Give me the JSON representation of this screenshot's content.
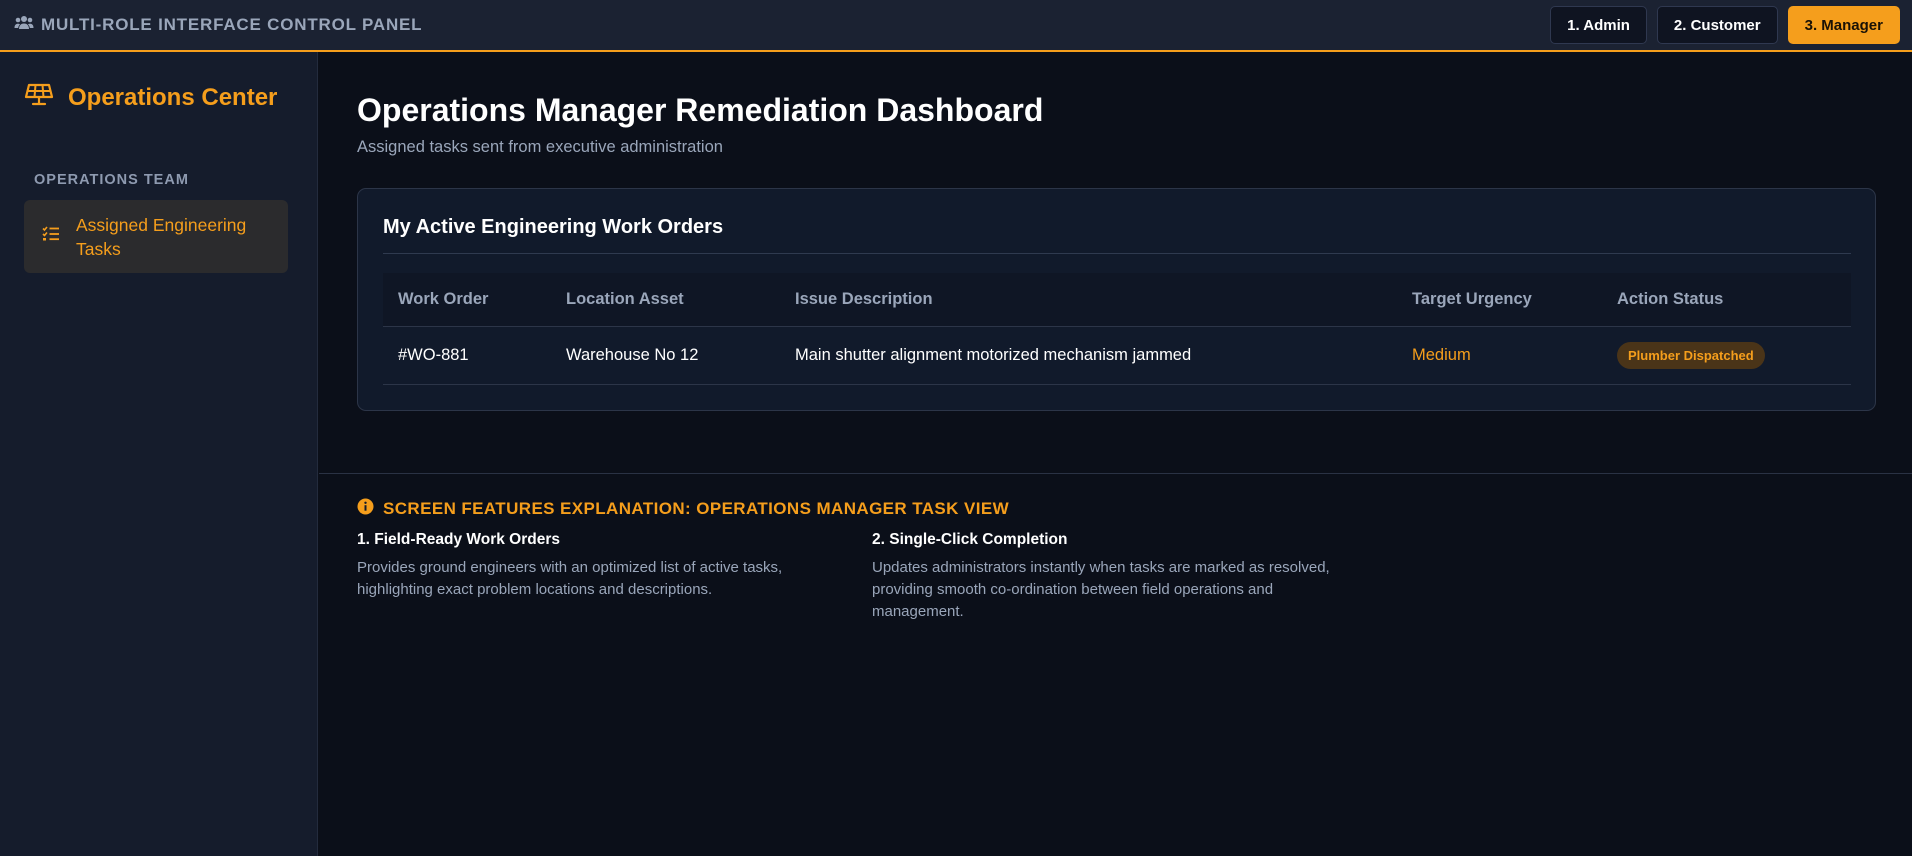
{
  "topbar": {
    "title": "MULTI-ROLE INTERFACE CONTROL PANEL",
    "icon": "users-icon",
    "roles": [
      {
        "label": "1. Admin",
        "active": false
      },
      {
        "label": "2. Customer",
        "active": false
      },
      {
        "label": "3. Manager",
        "active": true
      }
    ]
  },
  "sidebar": {
    "brand": "Operations Center",
    "brand_icon": "solar-panel-icon",
    "section_label": "OPERATIONS TEAM",
    "items": [
      {
        "label": "Assigned Engineering Tasks",
        "icon": "task-list-icon",
        "active": true
      }
    ]
  },
  "main": {
    "title": "Operations Manager Remediation Dashboard",
    "subtitle": "Assigned tasks sent from executive administration",
    "card": {
      "title": "My Active Engineering Work Orders",
      "columns": [
        "Work Order",
        "Location Asset",
        "Issue Description",
        "Target Urgency",
        "Action Status"
      ],
      "rows": [
        {
          "work_order": "#WO-881",
          "location": "Warehouse No 12",
          "issue": "Main shutter alignment motorized mechanism jammed",
          "urgency": "Medium",
          "status": "Plumber Dispatched"
        }
      ]
    },
    "explanation": {
      "icon": "info-icon",
      "title": "SCREEN FEATURES EXPLANATION: OPERATIONS MANAGER TASK VIEW",
      "features": [
        {
          "title": "1. Field-Ready Work Orders",
          "text": "Provides ground engineers with an optimized list of active tasks, highlighting exact problem locations and descriptions."
        },
        {
          "title": "2. Single-Click Completion",
          "text": "Updates administrators instantly when tasks are marked as resolved, providing smooth co-ordination between field operations and management."
        }
      ]
    }
  },
  "colors": {
    "accent": "#f59e1c",
    "background": "#0b0f19",
    "sidebar": "#151c2c",
    "topbar": "#1b2232"
  }
}
